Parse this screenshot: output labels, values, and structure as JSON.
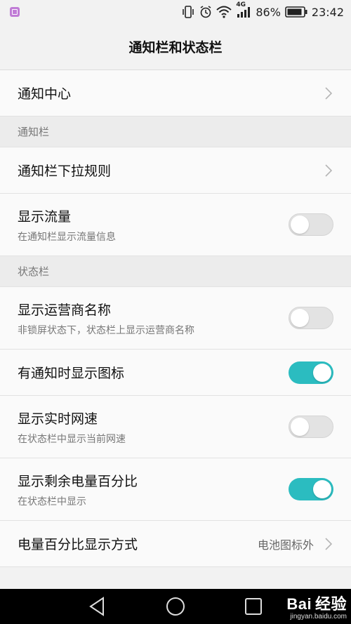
{
  "status_bar": {
    "network": "4G",
    "battery": "86%",
    "time": "23:42",
    "icons": [
      "gallery-notification-icon",
      "vibrate-icon",
      "alarm-icon",
      "wifi-icon",
      "signal-icon",
      "battery-icon"
    ]
  },
  "header": {
    "title": "通知栏和状态栏"
  },
  "items": {
    "notification_center": {
      "label": "通知中心"
    },
    "section_notification_bar": "通知栏",
    "pulldown_rules": {
      "label": "通知栏下拉规则"
    },
    "show_traffic": {
      "label": "显示流量",
      "desc": "在通知栏显示流量信息",
      "enabled": false
    },
    "section_status_bar": "状态栏",
    "show_carrier": {
      "label": "显示运营商名称",
      "desc": "非锁屏状态下，状态栏上显示运营商名称",
      "enabled": false
    },
    "notif_icons": {
      "label": "有通知时显示图标",
      "enabled": true
    },
    "network_speed": {
      "label": "显示实时网速",
      "desc": "在状态栏中显示当前网速",
      "enabled": false
    },
    "battery_percent": {
      "label": "显示剩余电量百分比",
      "desc": "在状态栏中显示",
      "enabled": true
    },
    "battery_display_mode": {
      "label": "电量百分比显示方式",
      "value": "电池图标外"
    }
  },
  "nav_bar": {
    "buttons": [
      "back-icon",
      "home-icon",
      "recents-icon"
    ]
  },
  "watermark": {
    "logo": "Bai 经验",
    "url": "jingyan.baidu.com"
  },
  "colors": {
    "accent": "#2bbcc0",
    "background": "#f2f2f2",
    "row": "#fafafa"
  }
}
